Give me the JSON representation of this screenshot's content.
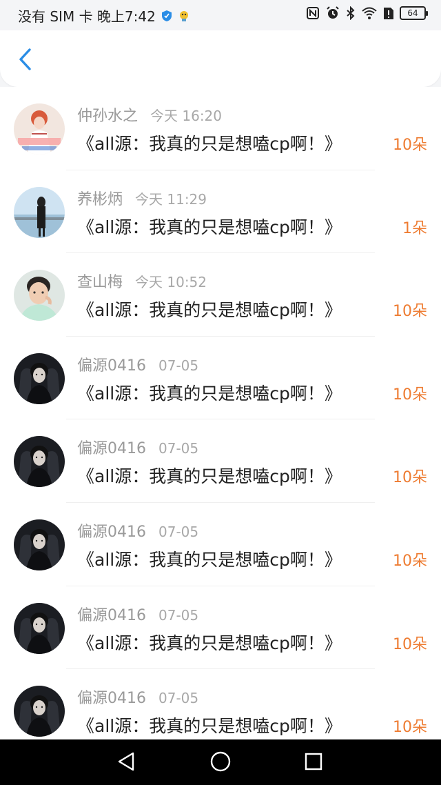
{
  "status_bar": {
    "carrier_time": "没有 SIM 卡 晚上7:42",
    "battery": "64"
  },
  "header": {
    "back_icon": "chevron-left-icon"
  },
  "list": {
    "items": [
      {
        "name": "仲孙水之",
        "time": "今天 16:20",
        "title": "《all源：我真的只是想嗑cp啊！》",
        "amount": "10朵",
        "avatar": "avatar-girl-illustration"
      },
      {
        "name": "养彬炳",
        "time": "今天 11:29",
        "title": "《all源：我真的只是想嗑cp啊！》",
        "amount": "1朵",
        "avatar": "avatar-girl-sea"
      },
      {
        "name": "查山梅",
        "time": "今天 10:52",
        "title": "《all源：我真的只是想嗑cp啊！》",
        "amount": "10朵",
        "avatar": "avatar-boy"
      },
      {
        "name": "偏源0416",
        "time": "07-05",
        "title": "《all源：我真的只是想嗑cp啊！》",
        "amount": "10朵",
        "avatar": "avatar-dark"
      },
      {
        "name": "偏源0416",
        "time": "07-05",
        "title": "《all源：我真的只是想嗑cp啊！》",
        "amount": "10朵",
        "avatar": "avatar-dark"
      },
      {
        "name": "偏源0416",
        "time": "07-05",
        "title": "《all源：我真的只是想嗑cp啊！》",
        "amount": "10朵",
        "avatar": "avatar-dark"
      },
      {
        "name": "偏源0416",
        "time": "07-05",
        "title": "《all源：我真的只是想嗑cp啊！》",
        "amount": "10朵",
        "avatar": "avatar-dark"
      },
      {
        "name": "偏源0416",
        "time": "07-05",
        "title": "《all源：我真的只是想嗑cp啊！》",
        "amount": "10朵",
        "avatar": "avatar-dark"
      }
    ]
  },
  "colors": {
    "accent_back": "#2a8de6",
    "amount": "#ee7c32",
    "name": "#9a9a9a",
    "title": "#222222"
  }
}
